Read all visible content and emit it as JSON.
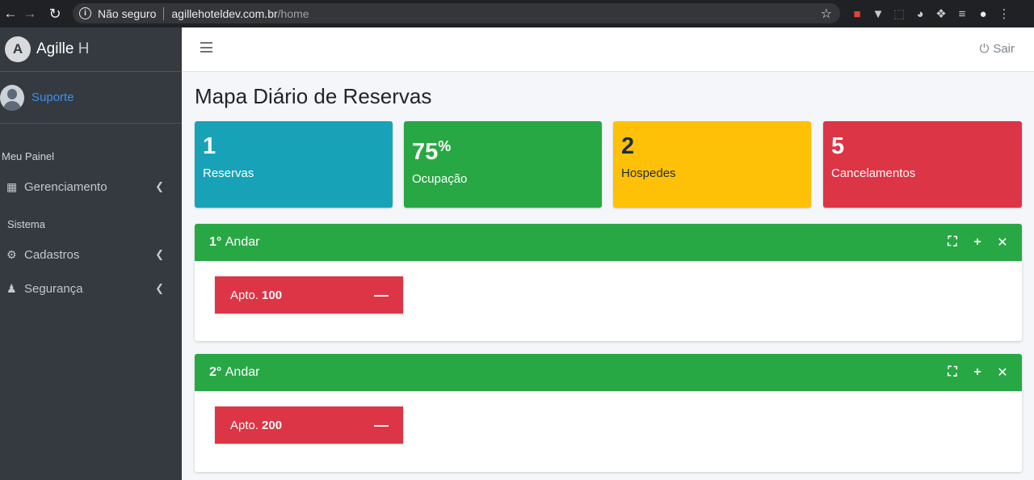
{
  "browser": {
    "back_icon": "arrow-left-icon",
    "forward_icon": "arrow-right-icon",
    "reload_icon": "reload-icon",
    "security_label": "Não seguro",
    "url_host": "agillehoteldev.com.br",
    "url_path": "/home"
  },
  "sidebar": {
    "brand_name": "Agille",
    "brand_suffix": "H",
    "brand_logo_letter": "A",
    "user_name": "Suporte",
    "section_panel": "Meu Painel",
    "section_system": "Sistema",
    "items": [
      {
        "label": "Gerenciamento",
        "icon": "dashboard-icon"
      },
      {
        "label": "Cadastros",
        "icon": "gears-icon"
      },
      {
        "label": "Segurança",
        "icon": "user-lock-icon"
      }
    ]
  },
  "topbar": {
    "logout_label": "Sair"
  },
  "page": {
    "title": "Mapa Diário de Reservas"
  },
  "stats": [
    {
      "value": "1",
      "label": "Reservas",
      "color": "#17a2b8"
    },
    {
      "value": "75",
      "suffix": "%",
      "label": "Ocupação",
      "color": "#28a745"
    },
    {
      "value": "2",
      "label": "Hospedes",
      "color": "#ffc107"
    },
    {
      "value": "5",
      "label": "Cancelamentos",
      "color": "#dc3545"
    }
  ],
  "floors": [
    {
      "number": "1°",
      "label": "Andar",
      "rooms": [
        {
          "prefix": "Apto.",
          "number": "100",
          "status_color": "#dc3545"
        }
      ]
    },
    {
      "number": "2°",
      "label": "Andar",
      "rooms": [
        {
          "prefix": "Apto.",
          "number": "200",
          "status_color": "#dc3545"
        }
      ]
    }
  ],
  "colors": {
    "sidebar_bg": "#343a40",
    "header_green": "#28a745",
    "link_blue": "#3f8fe8"
  }
}
